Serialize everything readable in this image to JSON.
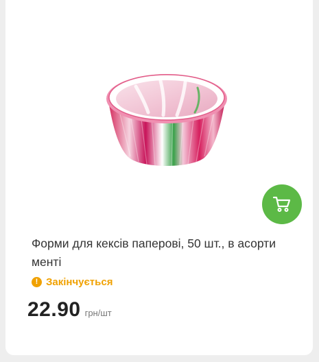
{
  "product": {
    "title": "Форми для кексів паперові, 50 шт., в асорти менті",
    "status": {
      "text": "Закінчується",
      "icon": "exclamation-icon",
      "icon_glyph": "!",
      "color": "#f0a100"
    },
    "price": "22.90",
    "unit": "грн/шт",
    "image_icon": "paper-cupcake-liners-image"
  },
  "actions": {
    "wishlist_icon": "heart-outline-icon",
    "cart_icon": "shopping-cart-icon",
    "cart_color": "#5cb946"
  }
}
